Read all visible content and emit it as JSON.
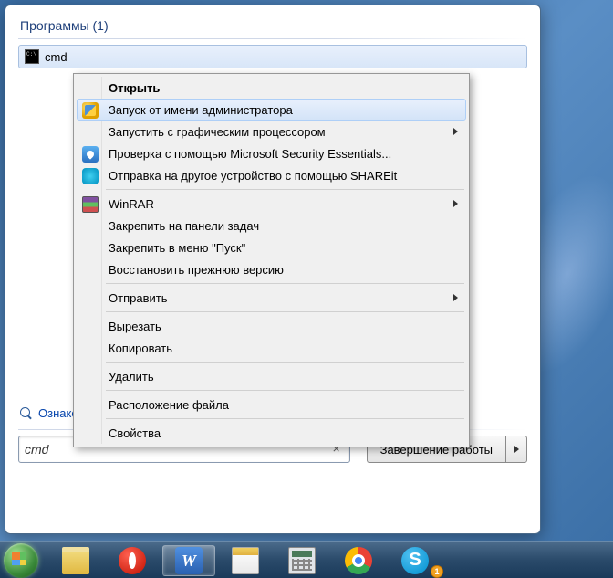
{
  "startPanel": {
    "sectionHeader": "Программы (1)",
    "result": {
      "label": "cmd"
    },
    "moreResults": "Ознакомиться с другими результатами",
    "searchValue": "cmd",
    "shutdownLabel": "Завершение работы"
  },
  "contextMenu": {
    "items": [
      {
        "label": "Открыть",
        "bold": true,
        "icon": null,
        "sub": false
      },
      {
        "label": "Запуск от имени администратора",
        "icon": "shield",
        "sub": false,
        "hover": true
      },
      {
        "label": "Запустить с графическим процессором",
        "icon": null,
        "sub": true
      },
      {
        "label": "Проверка с помощью Microsoft Security Essentials...",
        "icon": "mse",
        "sub": false
      },
      {
        "label": "Отправка на другое устройство с помощью SHAREit",
        "icon": "shareit",
        "sub": false
      },
      {
        "sep": true
      },
      {
        "label": "WinRAR",
        "icon": "rar",
        "sub": true
      },
      {
        "label": "Закрепить на панели задач",
        "icon": null,
        "sub": false
      },
      {
        "label": "Закрепить в меню \"Пуск\"",
        "icon": null,
        "sub": false
      },
      {
        "label": "Восстановить прежнюю версию",
        "icon": null,
        "sub": false
      },
      {
        "sep": true
      },
      {
        "label": "Отправить",
        "icon": null,
        "sub": true
      },
      {
        "sep": true
      },
      {
        "label": "Вырезать",
        "icon": null,
        "sub": false
      },
      {
        "label": "Копировать",
        "icon": null,
        "sub": false
      },
      {
        "sep": true
      },
      {
        "label": "Удалить",
        "icon": null,
        "sub": false
      },
      {
        "sep": true
      },
      {
        "label": "Расположение файла",
        "icon": null,
        "sub": false
      },
      {
        "sep": true
      },
      {
        "label": "Свойства",
        "icon": null,
        "sub": false
      }
    ]
  },
  "taskbar": {
    "skypeBadge": "1",
    "wordLetter": "W",
    "skypeLetter": "S"
  }
}
